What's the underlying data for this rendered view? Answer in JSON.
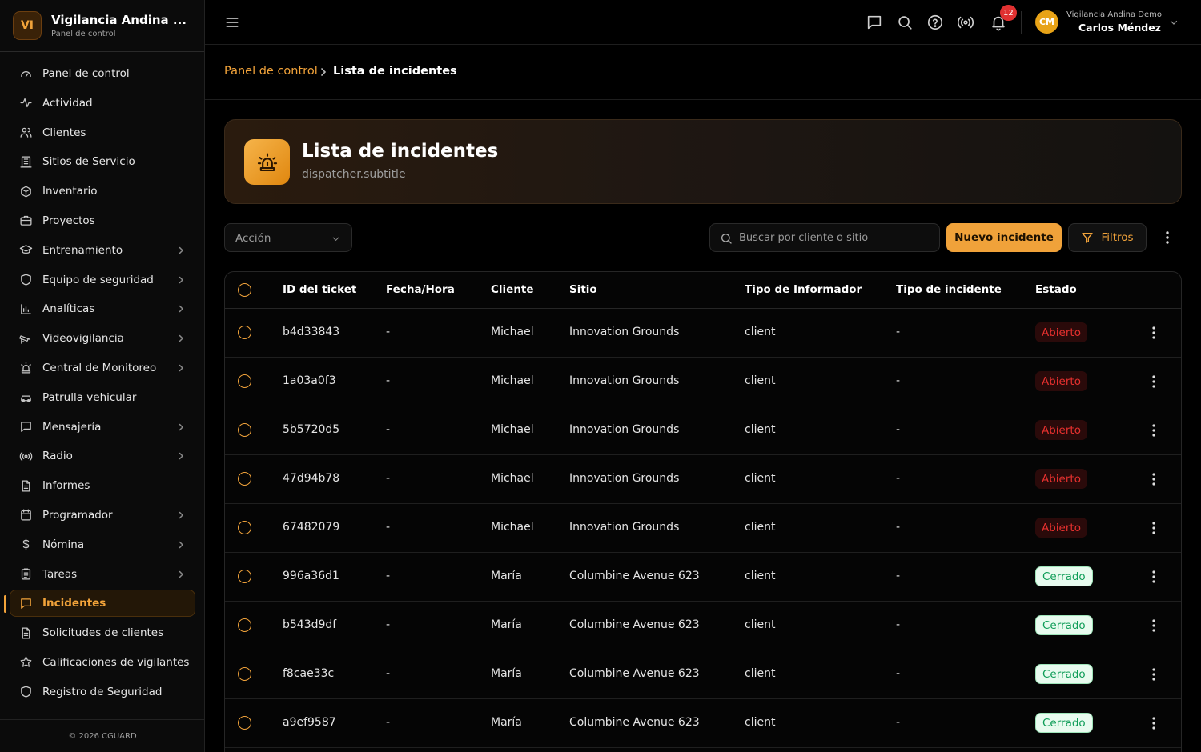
{
  "app": {
    "logo_initials": "VI",
    "name": "Vigilancia Andina ...",
    "subtitle": "Panel de control"
  },
  "sidebar": {
    "items": [
      {
        "label": "Panel de control",
        "icon": "gauge-icon",
        "chevron": false,
        "active": false
      },
      {
        "label": "Actividad",
        "icon": "activity-icon",
        "chevron": false,
        "active": false
      },
      {
        "label": "Clientes",
        "icon": "users-icon",
        "chevron": false,
        "active": false
      },
      {
        "label": "Sitios de Servicio",
        "icon": "building-icon",
        "chevron": false,
        "active": false
      },
      {
        "label": "Inventario",
        "icon": "box-icon",
        "chevron": false,
        "active": false
      },
      {
        "label": "Proyectos",
        "icon": "briefcase-icon",
        "chevron": false,
        "active": false
      },
      {
        "label": "Entrenamiento",
        "icon": "graduation-cap-icon",
        "chevron": true,
        "active": false
      },
      {
        "label": "Equipo de seguridad",
        "icon": "shield-icon",
        "chevron": true,
        "active": false
      },
      {
        "label": "Analíticas",
        "icon": "bar-chart-icon",
        "chevron": true,
        "active": false
      },
      {
        "label": "Videovigilancia",
        "icon": "cctv-icon",
        "chevron": true,
        "active": false
      },
      {
        "label": "Central de Monitoreo",
        "icon": "siren-icon",
        "chevron": true,
        "active": false
      },
      {
        "label": "Patrulla vehicular",
        "icon": "car-icon",
        "chevron": false,
        "active": false
      },
      {
        "label": "Mensajería",
        "icon": "message-icon",
        "chevron": true,
        "active": false
      },
      {
        "label": "Radio",
        "icon": "radio-icon",
        "chevron": true,
        "active": false
      },
      {
        "label": "Informes",
        "icon": "file-text-icon",
        "chevron": false,
        "active": false
      },
      {
        "label": "Programador",
        "icon": "calendar-icon",
        "chevron": true,
        "active": false
      },
      {
        "label": "Nómina",
        "icon": "dollar-icon",
        "chevron": true,
        "active": false
      },
      {
        "label": "Tareas",
        "icon": "clipboard-icon",
        "chevron": true,
        "active": false
      },
      {
        "label": "Incidentes",
        "icon": "message-square-icon",
        "chevron": false,
        "active": true
      },
      {
        "label": "Solicitudes de clientes",
        "icon": "file-text-icon",
        "chevron": false,
        "active": false
      },
      {
        "label": "Calificaciones de vigilantes",
        "icon": "star-icon",
        "chevron": false,
        "active": false
      },
      {
        "label": "Registro de Seguridad",
        "icon": "shield-icon",
        "chevron": false,
        "active": false
      }
    ],
    "footer": "© 2026 CGUARD"
  },
  "header": {
    "notification_count": "12",
    "user": {
      "initials": "CM",
      "org": "Vigilancia Andina Demo",
      "name": "Carlos Méndez"
    }
  },
  "breadcrumb": {
    "parent": "Panel de control",
    "current": "Lista de incidentes"
  },
  "page": {
    "title": "Lista de incidentes",
    "subtitle": "dispatcher.subtitle"
  },
  "toolbar": {
    "action_label": "Acción",
    "search_placeholder": "Buscar por cliente o sitio",
    "new_label": "Nuevo incidente",
    "filter_label": "Filtros"
  },
  "table": {
    "columns": [
      "ID del ticket",
      "Fecha/Hora",
      "Cliente",
      "Sitio",
      "Tipo de Informador",
      "Tipo de incidente",
      "Estado"
    ],
    "rows": [
      {
        "id": "b4d33843",
        "datetime": "-",
        "client": "Michael",
        "site": "Innovation Grounds",
        "reporter": "client",
        "type": "-",
        "status": "Abierto",
        "status_kind": "open"
      },
      {
        "id": "1a03a0f3",
        "datetime": "-",
        "client": "Michael",
        "site": "Innovation Grounds",
        "reporter": "client",
        "type": "-",
        "status": "Abierto",
        "status_kind": "open"
      },
      {
        "id": "5b5720d5",
        "datetime": "-",
        "client": "Michael",
        "site": "Innovation Grounds",
        "reporter": "client",
        "type": "-",
        "status": "Abierto",
        "status_kind": "open"
      },
      {
        "id": "47d94b78",
        "datetime": "-",
        "client": "Michael",
        "site": "Innovation Grounds",
        "reporter": "client",
        "type": "-",
        "status": "Abierto",
        "status_kind": "open"
      },
      {
        "id": "67482079",
        "datetime": "-",
        "client": "Michael",
        "site": "Innovation Grounds",
        "reporter": "client",
        "type": "-",
        "status": "Abierto",
        "status_kind": "open"
      },
      {
        "id": "996a36d1",
        "datetime": "-",
        "client": "María",
        "site": "Columbine Avenue 623",
        "reporter": "client",
        "type": "-",
        "status": "Cerrado",
        "status_kind": "closed"
      },
      {
        "id": "b543d9df",
        "datetime": "-",
        "client": "María",
        "site": "Columbine Avenue 623",
        "reporter": "client",
        "type": "-",
        "status": "Cerrado",
        "status_kind": "closed"
      },
      {
        "id": "f8cae33c",
        "datetime": "-",
        "client": "María",
        "site": "Columbine Avenue 623",
        "reporter": "client",
        "type": "-",
        "status": "Cerrado",
        "status_kind": "closed"
      },
      {
        "id": "a9ef9587",
        "datetime": "-",
        "client": "María",
        "site": "Columbine Avenue 623",
        "reporter": "client",
        "type": "-",
        "status": "Cerrado",
        "status_kind": "closed"
      }
    ]
  },
  "colors": {
    "accent": "#f0a23a",
    "open": "#e5302e",
    "closed": "#0f9d58",
    "badge": "#e03131"
  }
}
